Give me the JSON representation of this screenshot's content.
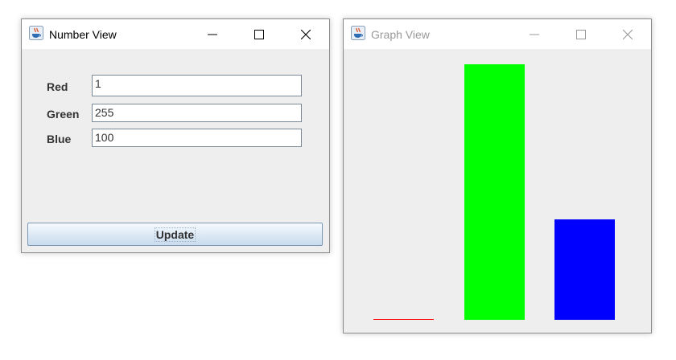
{
  "number_view": {
    "title": "Number View",
    "fields": [
      {
        "label": "Red",
        "value": "1"
      },
      {
        "label": "Green",
        "value": "255"
      },
      {
        "label": "Blue",
        "value": "100"
      }
    ],
    "update_label": "Update"
  },
  "graph_view": {
    "title": "Graph View",
    "max_value": 255,
    "bars": [
      {
        "channel": "red",
        "value": 1,
        "color": "#ff0000"
      },
      {
        "channel": "green",
        "value": 255,
        "color": "#00ff00"
      },
      {
        "channel": "blue",
        "value": 100,
        "color": "#0000ff"
      }
    ]
  },
  "icons": {
    "app": "java-cup-icon",
    "minimize": "minimize-icon",
    "maximize": "maximize-icon",
    "close": "close-icon"
  }
}
